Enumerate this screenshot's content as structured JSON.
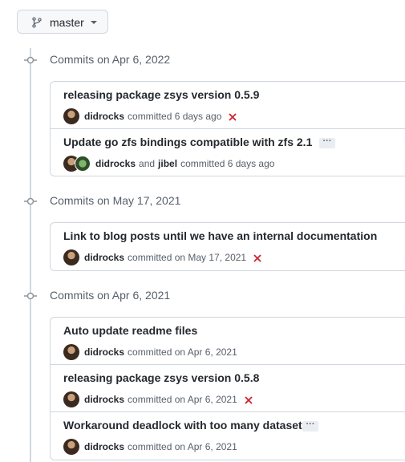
{
  "branch": {
    "label": "master"
  },
  "groups": [
    {
      "title": "Commits on Apr 6, 2022",
      "commits": [
        {
          "message": "releasing package zsys version 0.5.9",
          "author": "didrocks",
          "when": "committed 6 days ago",
          "status": "failure"
        },
        {
          "message": "Update go zfs bindings compatible with zfs 2.1",
          "author": "didrocks",
          "and": "and",
          "coauthor": "jibel",
          "when": "committed 6 days ago",
          "ellipsis": "···"
        }
      ]
    },
    {
      "title": "Commits on May 17, 2021",
      "commits": [
        {
          "message": "Link to blog posts until we have an internal documentation",
          "author": "didrocks",
          "when": "committed on May 17, 2021",
          "status": "failure"
        }
      ]
    },
    {
      "title": "Commits on Apr 6, 2021",
      "commits": [
        {
          "message": "Auto update readme files",
          "author": "didrocks",
          "when": "committed on Apr 6, 2021"
        },
        {
          "message": "releasing package zsys version 0.5.8",
          "author": "didrocks",
          "when": "committed on Apr 6, 2021",
          "status": "failure"
        },
        {
          "message": "Workaround deadlock with too many datasets",
          "author": "didrocks",
          "when": "committed on Apr 6, 2021",
          "ellipsis": "···"
        }
      ]
    }
  ],
  "colors": {
    "failure": "#cf222e",
    "border": "#d0d7de",
    "muted": "#57606a",
    "text": "#24292f"
  }
}
